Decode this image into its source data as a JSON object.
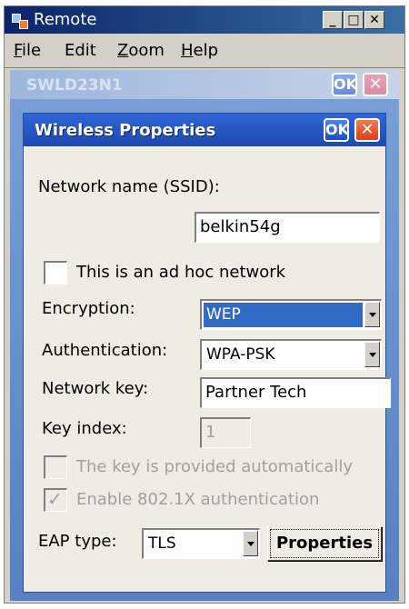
{
  "window": {
    "title": "Remote",
    "minimize": "_",
    "maximize": "□",
    "close": "✕"
  },
  "menu": {
    "items": [
      {
        "first": "F",
        "rest": "ile"
      },
      {
        "first": "E",
        "rest": "dit"
      },
      {
        "first": "Z",
        "rest": "oom"
      },
      {
        "first": "H",
        "rest": "elp"
      }
    ]
  },
  "background_dialog": {
    "title": "SWLD23N1",
    "ok": "OK",
    "close": "✕"
  },
  "dialog": {
    "title": "Wireless Properties",
    "ok": "OK",
    "close": "✕",
    "network_name_label": "Network name (SSID):",
    "network_name_value": "belkin54g",
    "adhoc_label": "This is an ad hoc network",
    "adhoc_checked": false,
    "encryption_label": "Encryption:",
    "encryption_value": "WEP",
    "authentication_label": "Authentication:",
    "authentication_value": "WPA-PSK",
    "network_key_label": "Network key:",
    "network_key_value": "Partner Tech",
    "key_index_label": "Key index:",
    "key_index_value": "1",
    "auto_key_label": "The key is provided automatically",
    "auto_key_checked": false,
    "dot1x_label": "Enable 802.1X authentication",
    "dot1x_checked": true,
    "eap_type_label": "EAP type:",
    "eap_type_value": "TLS",
    "properties_button": "Properties"
  },
  "colors": {
    "title_bar": "#0a246a",
    "dialog_title": "#2f66d6",
    "selection": "#316ac5",
    "ok_button": "#1b4fc4",
    "close_button": "#d8421c"
  }
}
